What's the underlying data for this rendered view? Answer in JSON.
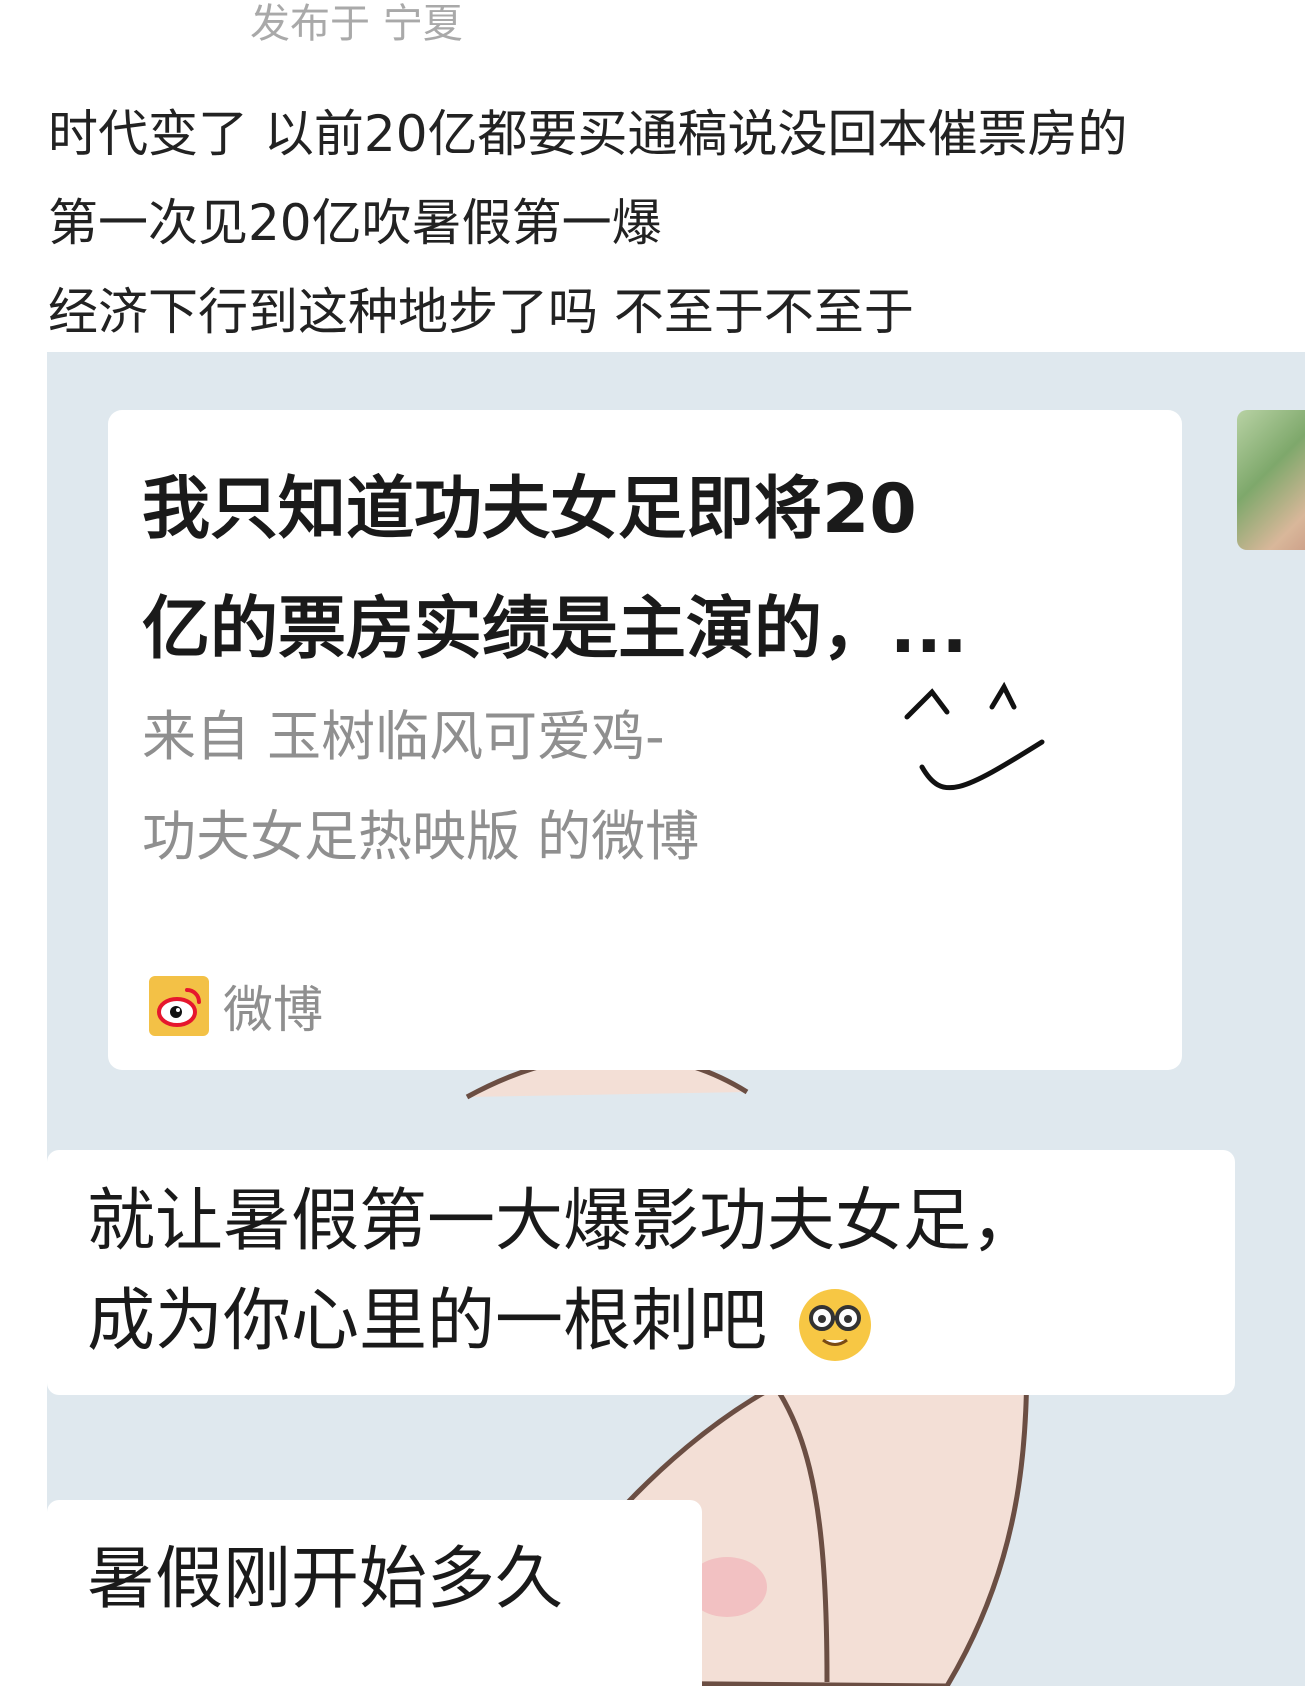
{
  "post": {
    "location_text": "发布于 宁夏",
    "lines": [
      "时代变了 以前20亿都要买通稿说没回本催票房的",
      "第一次见20亿吹暑假第一爆",
      "经济下行到这种地步了吗 不至于不至于"
    ]
  },
  "chat": {
    "share_card": {
      "title_lines": [
        "我只知道功夫女足即将20",
        "亿的票房实绩是主演的，..."
      ],
      "source_lines": [
        "来自 玉树临风可爱鸡-",
        "功夫女足热映版 的微博"
      ],
      "brand_label": "微博"
    },
    "messages": [
      {
        "lines": [
          "就让暑假第一大爆影功夫女足，",
          "成为你心里的一根刺吧"
        ],
        "emoji": "nerd-face-emoji"
      },
      {
        "lines": [
          "暑假刚开始多久"
        ]
      }
    ],
    "colors": {
      "chat_background": "#dfe8ee",
      "bubble": "#ffffff",
      "brand_logo": "#f3c146",
      "brand_eye": "#e6162d"
    }
  }
}
